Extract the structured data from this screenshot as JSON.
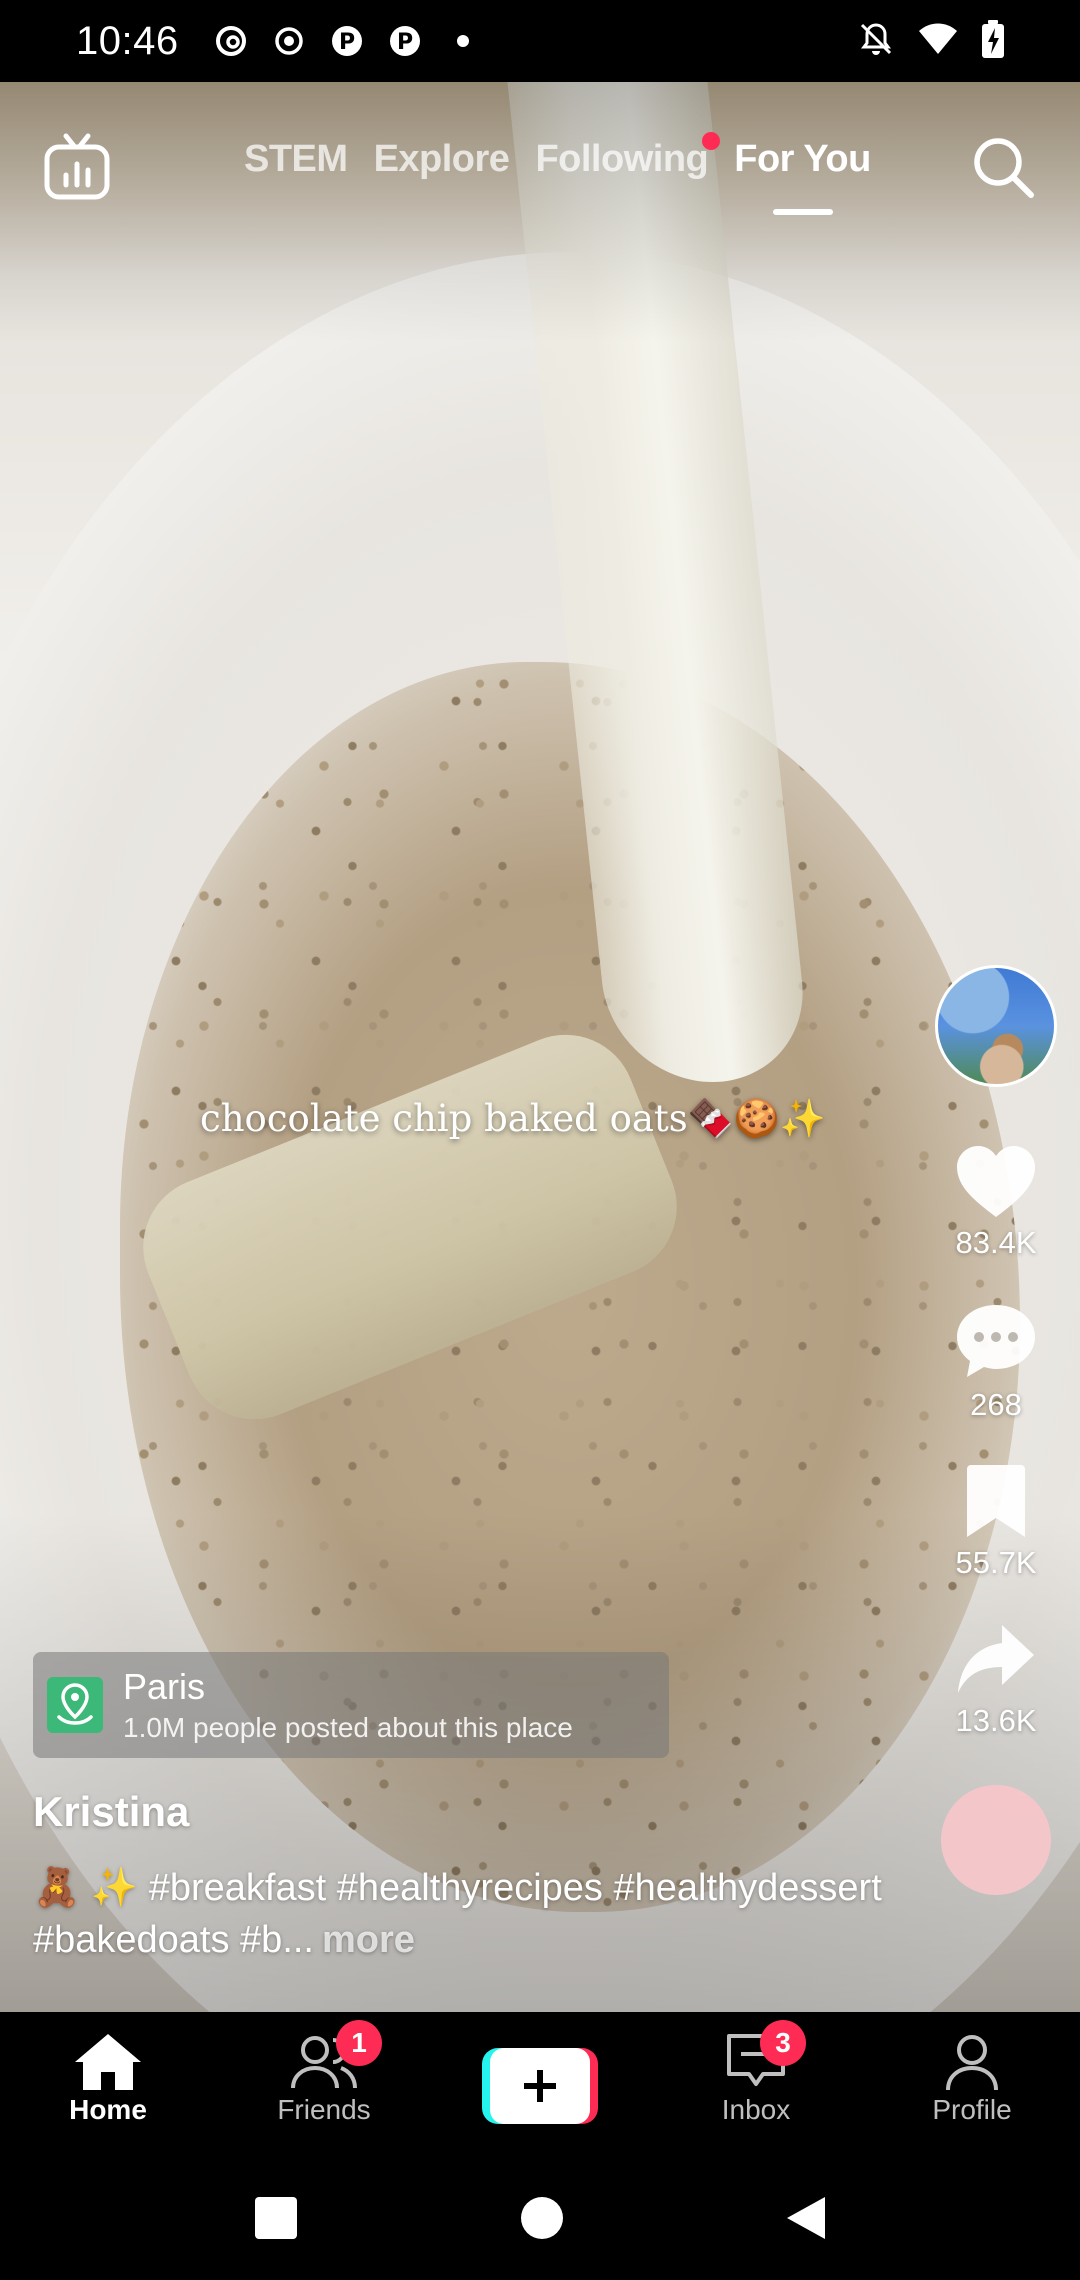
{
  "status_bar": {
    "time": "10:46",
    "left_icons": [
      "threads-icon",
      "record-icon",
      "pinterest-icon",
      "pinterest-icon",
      "dot-icon"
    ],
    "right_icons": [
      "mute-icon",
      "wifi-icon",
      "battery-charging-icon"
    ]
  },
  "top_nav": {
    "tabs": [
      {
        "label": "STEM"
      },
      {
        "label": "Explore"
      },
      {
        "label": "Following",
        "has_dot": true
      },
      {
        "label": "For You",
        "active": true
      }
    ]
  },
  "video": {
    "overlay_text": "chocolate chip baked oats🍫🍪✨"
  },
  "rail": {
    "likes": "83.4K",
    "comments": "268",
    "saves": "55.7K",
    "shares": "13.6K"
  },
  "location": {
    "name": "Paris",
    "subtitle": "1.0M people posted about this place"
  },
  "post": {
    "username": "Kristina",
    "caption": "🧸 ✨ #breakfast #healthyrecipes #healthydessert #bakedoats #b...",
    "more_label": "more"
  },
  "bottom_nav": {
    "items": [
      {
        "label": "Home",
        "icon": "home-icon",
        "active": true
      },
      {
        "label": "Friends",
        "icon": "friends-icon",
        "badge": "1"
      },
      {
        "label": "",
        "icon": "plus-icon"
      },
      {
        "label": "Inbox",
        "icon": "inbox-icon",
        "badge": "3"
      },
      {
        "label": "Profile",
        "icon": "profile-icon"
      }
    ]
  },
  "colors": {
    "accent": "#fe2c55",
    "cyan": "#25f4ee",
    "location_green": "#3cb878"
  }
}
